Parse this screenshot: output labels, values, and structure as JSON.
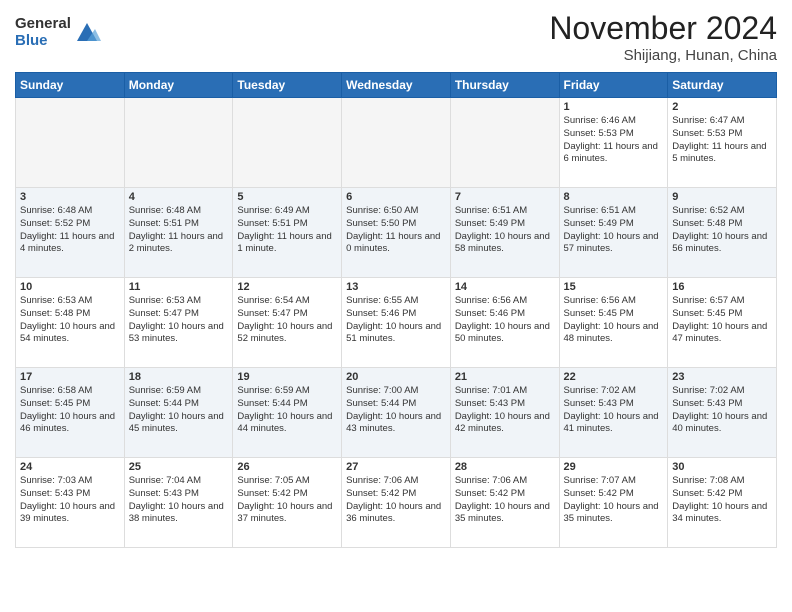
{
  "header": {
    "logo_general": "General",
    "logo_blue": "Blue",
    "month_title": "November 2024",
    "subtitle": "Shijiang, Hunan, China"
  },
  "weekdays": [
    "Sunday",
    "Monday",
    "Tuesday",
    "Wednesday",
    "Thursday",
    "Friday",
    "Saturday"
  ],
  "weeks": [
    [
      {
        "day": "",
        "sunrise": "",
        "sunset": "",
        "daylight": ""
      },
      {
        "day": "",
        "sunrise": "",
        "sunset": "",
        "daylight": ""
      },
      {
        "day": "",
        "sunrise": "",
        "sunset": "",
        "daylight": ""
      },
      {
        "day": "",
        "sunrise": "",
        "sunset": "",
        "daylight": ""
      },
      {
        "day": "",
        "sunrise": "",
        "sunset": "",
        "daylight": ""
      },
      {
        "day": "1",
        "sunrise": "6:46 AM",
        "sunset": "5:53 PM",
        "daylight": "11 hours and 6 minutes."
      },
      {
        "day": "2",
        "sunrise": "6:47 AM",
        "sunset": "5:53 PM",
        "daylight": "11 hours and 5 minutes."
      }
    ],
    [
      {
        "day": "3",
        "sunrise": "6:48 AM",
        "sunset": "5:52 PM",
        "daylight": "11 hours and 4 minutes."
      },
      {
        "day": "4",
        "sunrise": "6:48 AM",
        "sunset": "5:51 PM",
        "daylight": "11 hours and 2 minutes."
      },
      {
        "day": "5",
        "sunrise": "6:49 AM",
        "sunset": "5:51 PM",
        "daylight": "11 hours and 1 minute."
      },
      {
        "day": "6",
        "sunrise": "6:50 AM",
        "sunset": "5:50 PM",
        "daylight": "11 hours and 0 minutes."
      },
      {
        "day": "7",
        "sunrise": "6:51 AM",
        "sunset": "5:49 PM",
        "daylight": "10 hours and 58 minutes."
      },
      {
        "day": "8",
        "sunrise": "6:51 AM",
        "sunset": "5:49 PM",
        "daylight": "10 hours and 57 minutes."
      },
      {
        "day": "9",
        "sunrise": "6:52 AM",
        "sunset": "5:48 PM",
        "daylight": "10 hours and 56 minutes."
      }
    ],
    [
      {
        "day": "10",
        "sunrise": "6:53 AM",
        "sunset": "5:48 PM",
        "daylight": "10 hours and 54 minutes."
      },
      {
        "day": "11",
        "sunrise": "6:53 AM",
        "sunset": "5:47 PM",
        "daylight": "10 hours and 53 minutes."
      },
      {
        "day": "12",
        "sunrise": "6:54 AM",
        "sunset": "5:47 PM",
        "daylight": "10 hours and 52 minutes."
      },
      {
        "day": "13",
        "sunrise": "6:55 AM",
        "sunset": "5:46 PM",
        "daylight": "10 hours and 51 minutes."
      },
      {
        "day": "14",
        "sunrise": "6:56 AM",
        "sunset": "5:46 PM",
        "daylight": "10 hours and 50 minutes."
      },
      {
        "day": "15",
        "sunrise": "6:56 AM",
        "sunset": "5:45 PM",
        "daylight": "10 hours and 48 minutes."
      },
      {
        "day": "16",
        "sunrise": "6:57 AM",
        "sunset": "5:45 PM",
        "daylight": "10 hours and 47 minutes."
      }
    ],
    [
      {
        "day": "17",
        "sunrise": "6:58 AM",
        "sunset": "5:45 PM",
        "daylight": "10 hours and 46 minutes."
      },
      {
        "day": "18",
        "sunrise": "6:59 AM",
        "sunset": "5:44 PM",
        "daylight": "10 hours and 45 minutes."
      },
      {
        "day": "19",
        "sunrise": "6:59 AM",
        "sunset": "5:44 PM",
        "daylight": "10 hours and 44 minutes."
      },
      {
        "day": "20",
        "sunrise": "7:00 AM",
        "sunset": "5:44 PM",
        "daylight": "10 hours and 43 minutes."
      },
      {
        "day": "21",
        "sunrise": "7:01 AM",
        "sunset": "5:43 PM",
        "daylight": "10 hours and 42 minutes."
      },
      {
        "day": "22",
        "sunrise": "7:02 AM",
        "sunset": "5:43 PM",
        "daylight": "10 hours and 41 minutes."
      },
      {
        "day": "23",
        "sunrise": "7:02 AM",
        "sunset": "5:43 PM",
        "daylight": "10 hours and 40 minutes."
      }
    ],
    [
      {
        "day": "24",
        "sunrise": "7:03 AM",
        "sunset": "5:43 PM",
        "daylight": "10 hours and 39 minutes."
      },
      {
        "day": "25",
        "sunrise": "7:04 AM",
        "sunset": "5:43 PM",
        "daylight": "10 hours and 38 minutes."
      },
      {
        "day": "26",
        "sunrise": "7:05 AM",
        "sunset": "5:42 PM",
        "daylight": "10 hours and 37 minutes."
      },
      {
        "day": "27",
        "sunrise": "7:06 AM",
        "sunset": "5:42 PM",
        "daylight": "10 hours and 36 minutes."
      },
      {
        "day": "28",
        "sunrise": "7:06 AM",
        "sunset": "5:42 PM",
        "daylight": "10 hours and 35 minutes."
      },
      {
        "day": "29",
        "sunrise": "7:07 AM",
        "sunset": "5:42 PM",
        "daylight": "10 hours and 35 minutes."
      },
      {
        "day": "30",
        "sunrise": "7:08 AM",
        "sunset": "5:42 PM",
        "daylight": "10 hours and 34 minutes."
      }
    ]
  ]
}
